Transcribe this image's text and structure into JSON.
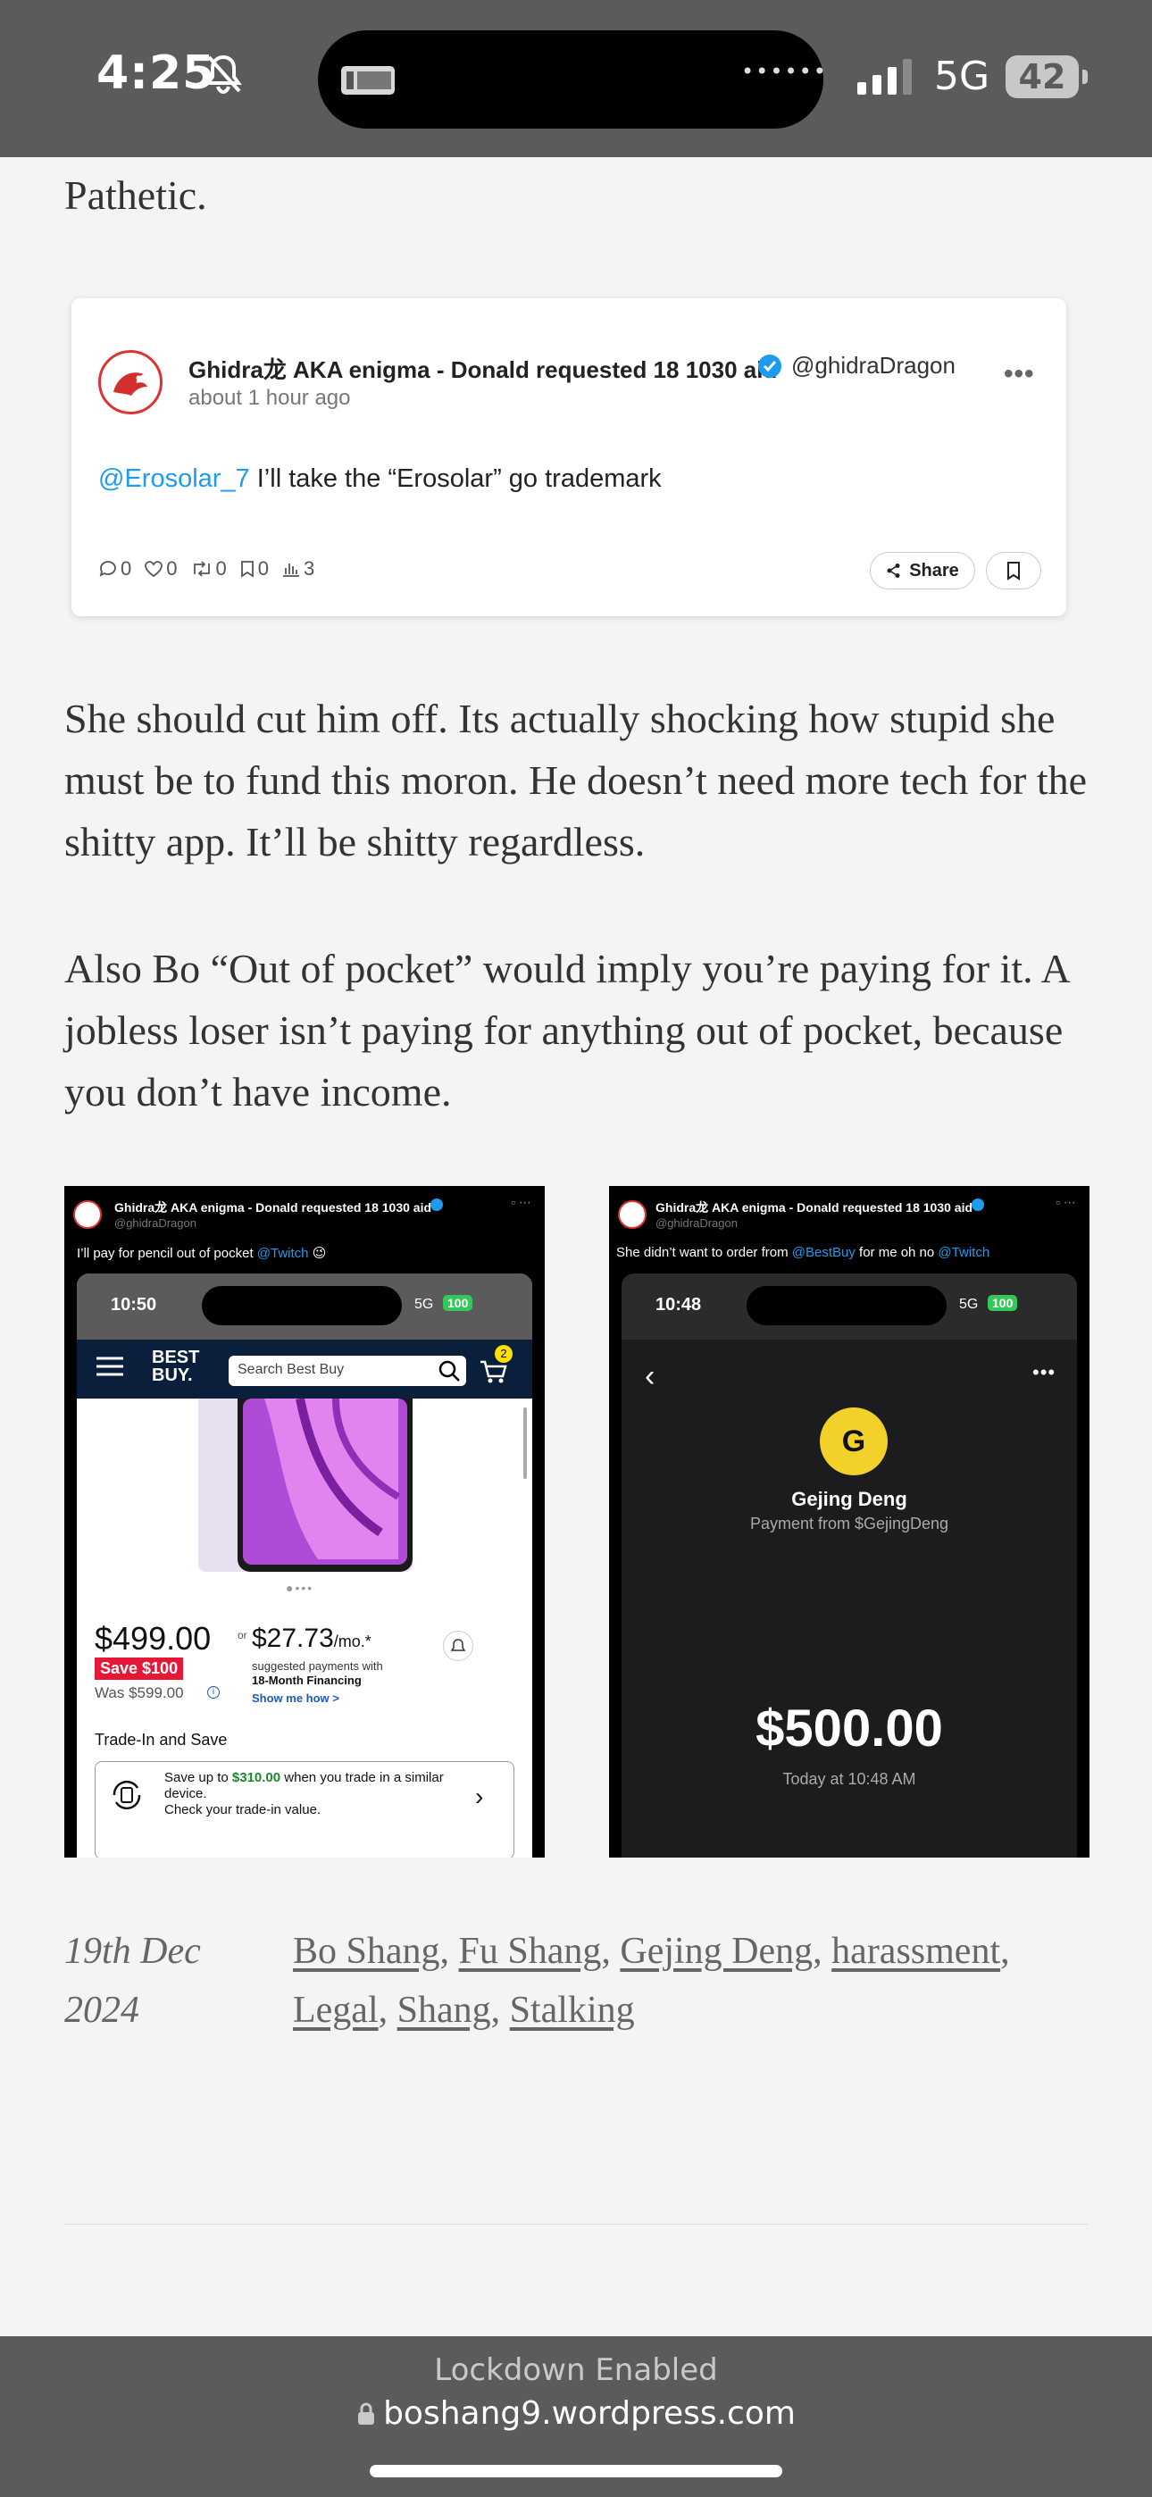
{
  "status_bar": {
    "time": "4:25",
    "network": "5G",
    "battery": "42"
  },
  "intro_text": "Pathetic.",
  "embedded_tweet": {
    "author_name": "Ghidra龙 AKA enigma - Donald requested 18 1030 aid",
    "handle": "@ghidraDragon",
    "timestamp": "about 1 hour ago",
    "mention": "@Erosolar_7",
    "body": " I’ll take the “Erosolar” go trademark",
    "stats": {
      "replies": "0",
      "likes": "0",
      "retweets": "0",
      "bookmarks": "0",
      "views": "3"
    },
    "share_label": "Share"
  },
  "paragraphs": [
    "She should cut him off. Its actually shocking how stupid she must be to fund this moron. He doesn’t need more tech for the shitty app. It’ll be shitty regardless.",
    "Also Bo “Out of pocket” would imply you’re paying for it. A jobless loser isn’t paying for anything out of pocket, because you don’t have income."
  ],
  "screenshot_left": {
    "author_name": "Ghidra龙 AKA enigma - Donald requested 18 1030 aid",
    "handle": "@ghidraDragon",
    "body_prefix": "I’ll pay for pencil out of pocket ",
    "mention": "@Twitch",
    "emoji": "😉",
    "phone": {
      "time": "10:50",
      "network": "5G",
      "battery": "100",
      "store_logo_line1": "BEST",
      "store_logo_line2": "BUY.",
      "search_placeholder": "Search Best Buy",
      "cart_count": "2",
      "price": "$499.00",
      "or": "or",
      "save_badge": "Save $100",
      "was_price": "Was $599.00",
      "monthly": "$27.73",
      "monthly_unit": "/mo.*",
      "monthly_note": "suggested payments with",
      "financing": "18-Month Financing",
      "show_me": "Show me how >",
      "trade_heading": "Trade-In and Save",
      "trade_text_prefix": "Save up to ",
      "trade_amount": "$310.00",
      "trade_text_suffix": " when you trade in a similar device.",
      "trade_check": "Check your trade-in value."
    }
  },
  "screenshot_right": {
    "author_name": "Ghidra龙 AKA enigma - Donald requested 18 1030 aid",
    "handle": "@ghidraDragon",
    "body_prefix": "She didn’t want to order from ",
    "mention1": "@BestBuy",
    "body_mid": " for me oh no ",
    "mention2": "@Twitch",
    "phone": {
      "time": "10:48",
      "network": "5G",
      "battery": "100",
      "avatar_letter": "G",
      "payer_name": "Gejing Deng",
      "payment_from": "Payment from $GejingDeng",
      "amount": "$500.00",
      "timestamp": "Today at 10:48 AM"
    }
  },
  "post_footer": {
    "date": "19th Dec 2024",
    "tags": [
      "Bo Shang",
      "Fu Shang",
      "Gejing Deng",
      "harassment",
      "Legal",
      "Shang",
      "Stalking"
    ]
  },
  "browser_bar": {
    "lockdown": "Lockdown Enabled",
    "url": "boshang9.wordpress.com"
  },
  "colors": {
    "link_blue": "#1d9bf0",
    "status_bar_bg": "#5b5b5b",
    "page_bg": "#f4f4f4",
    "cashapp_avatar": "#f2d12a",
    "bestbuy_blue": "#0a1f3b",
    "save_red": "#e51937",
    "battery_green": "#34c759"
  }
}
